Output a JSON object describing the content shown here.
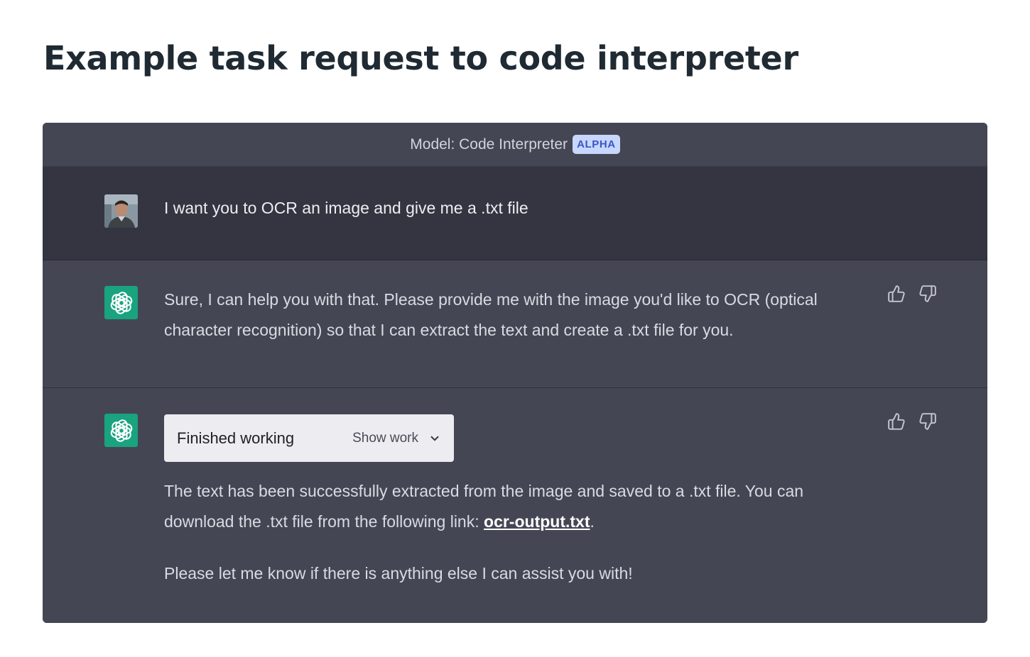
{
  "page": {
    "title": "Example task request to code interpreter"
  },
  "header": {
    "model_label": "Model: Code Interpreter",
    "badge": "ALPHA"
  },
  "messages": {
    "user": {
      "text": "I want you to OCR an image and give me a .txt file",
      "avatar": "user-photo"
    },
    "assistant_1": {
      "text": "Sure, I can help you with that. Please provide me with the image you'd like to OCR (optical character recognition) so that I can extract the text and create a .txt file for you.",
      "avatar": "openai-logo-icon"
    },
    "assistant_2": {
      "avatar": "openai-logo-icon",
      "work_status": "Finished working",
      "show_work_label": "Show work",
      "para1_before": "The text has been successfully extracted from the image and saved to a .txt file. You can download the .txt file from the following link: ",
      "link_text": "ocr-output.txt",
      "para1_after": ".",
      "para2": "Please let me know if there is anything else I can assist you with!"
    }
  },
  "icons": {
    "like": "thumbs-up-icon",
    "dislike": "thumbs-down-icon",
    "expand": "chevron-down-icon"
  },
  "colors": {
    "assistant_bg": "#444654",
    "user_bg": "#343541",
    "bot_avatar": "#19a37f",
    "badge_bg": "#c7d7fe",
    "badge_text": "#3a55c4"
  }
}
